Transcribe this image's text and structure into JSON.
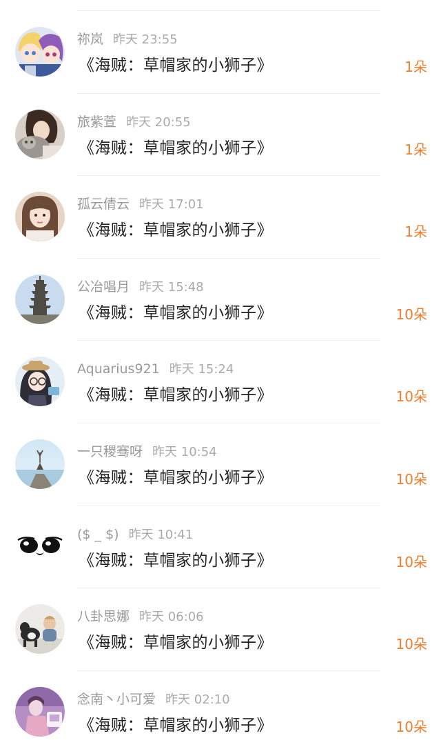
{
  "accent_color": "#f07b2c",
  "gifts": [
    {
      "user": "祢岚",
      "time": "昨天 23:55",
      "title": "《海贼：草帽家的小狮子》",
      "amount": "1朵",
      "avatar_icon": "anime-couple-avatar"
    },
    {
      "user": "旅紫萱",
      "time": "昨天 20:55",
      "title": "《海贼：草帽家的小狮子》",
      "amount": "1朵",
      "avatar_icon": "girl-with-cat-avatar"
    },
    {
      "user": "孤云倩云",
      "time": "昨天 17:01",
      "title": "《海贼：草帽家的小狮子》",
      "amount": "1朵",
      "avatar_icon": "girl-portrait-avatar"
    },
    {
      "user": "公冶唱月",
      "time": "昨天 15:48",
      "title": "《海贼：草帽家的小狮子》",
      "amount": "10朵",
      "avatar_icon": "pagoda-avatar"
    },
    {
      "user": "Aquarius921",
      "time": "昨天 15:24",
      "title": "《海贼：草帽家的小狮子》",
      "amount": "10朵",
      "avatar_icon": "anime-girl-hat-avatar"
    },
    {
      "user": "一只稷骞呀",
      "time": "昨天 10:54",
      "title": "《海贼：草帽家的小狮子》",
      "amount": "10朵",
      "avatar_icon": "yoga-pier-avatar"
    },
    {
      "user": "($ _ $)",
      "time": "昨天 10:41",
      "title": "《海贼：草帽家的小狮子》",
      "amount": "10朵",
      "avatar_icon": "cartoon-eyes-avatar"
    },
    {
      "user": "八卦思娜",
      "time": "昨天 06:06",
      "title": "《海贼：草帽家的小狮子》",
      "amount": "10朵",
      "avatar_icon": "baby-with-dog-avatar"
    },
    {
      "user": "念南丶小可爱",
      "time": "昨天 02:10",
      "title": "《海贼：草帽家的小狮子》",
      "amount": "10朵",
      "avatar_icon": "pink-room-avatar"
    }
  ]
}
